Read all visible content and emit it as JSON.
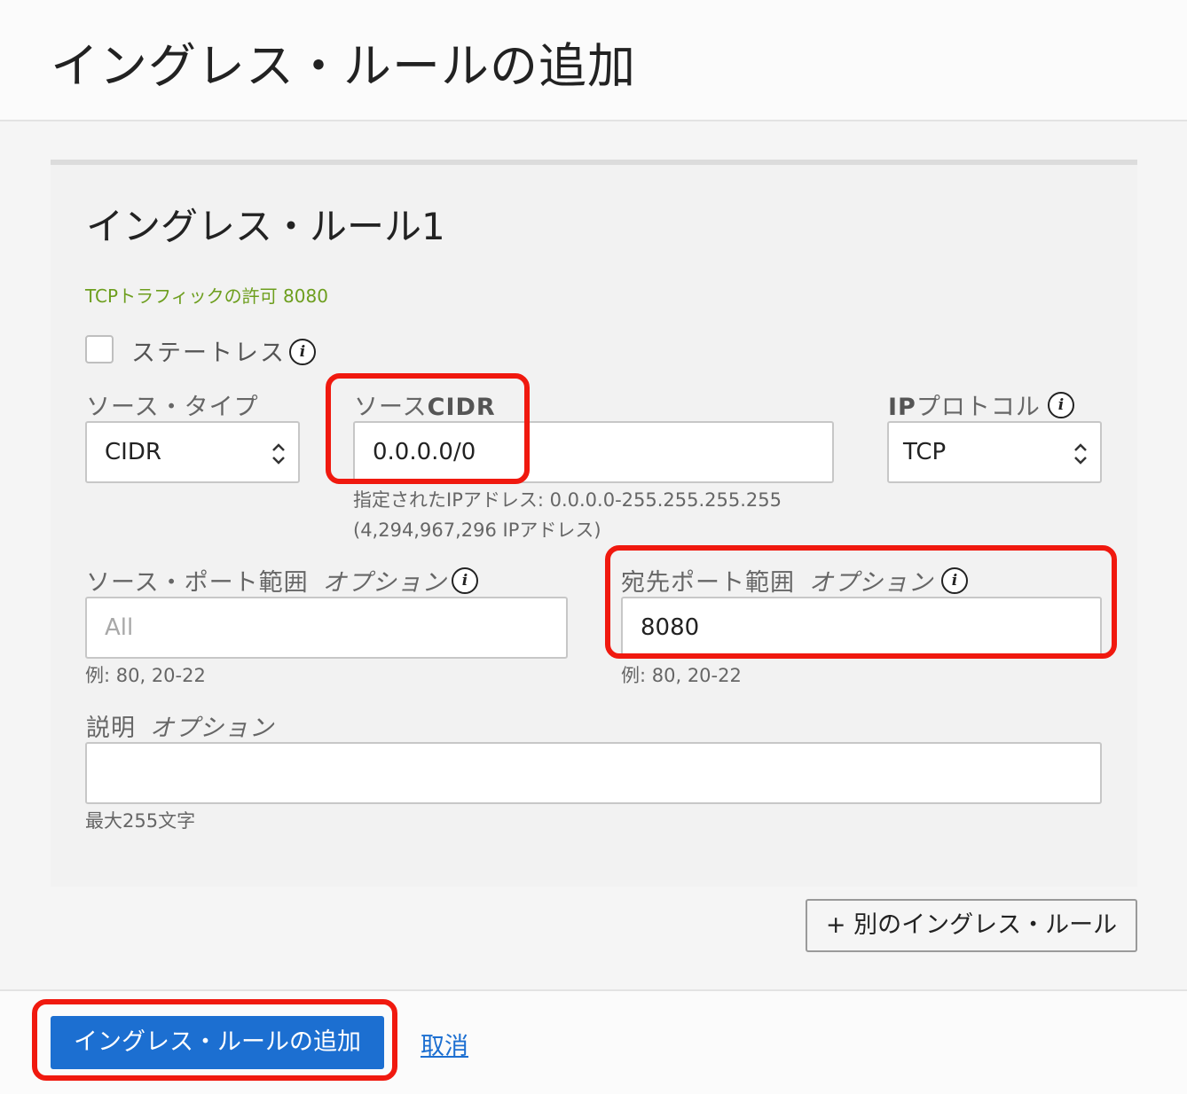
{
  "header": {
    "title": "イングレス・ルールの追加"
  },
  "panel": {
    "title": "イングレス・ルール1",
    "hint": "TCPトラフィックの許可 8080",
    "stateless_label": "ステートレス",
    "stateless_checked": false
  },
  "source_type": {
    "label": "ソース・タイプ",
    "value": "CIDR"
  },
  "source_cidr": {
    "label_prefix": "ソース",
    "label_bold": "CIDR",
    "value": "0.0.0.0/0",
    "helper_line1": "指定されたIPアドレス: 0.0.0.0-255.255.255.255",
    "helper_line2": "(4,294,967,296 IPアドレス)"
  },
  "ip_protocol": {
    "label_bold": "IP",
    "label_rest": "プロトコル",
    "value": "TCP"
  },
  "source_port": {
    "label": "ソース・ポート範囲",
    "optional": "オプション",
    "placeholder": "All",
    "helper": "例: 80, 20-22"
  },
  "dest_port": {
    "label": "宛先ポート範囲",
    "optional": "オプション",
    "value": "8080",
    "helper": "例: 80, 20-22"
  },
  "description": {
    "label": "説明",
    "optional": "オプション",
    "value": "",
    "helper": "最大255文字"
  },
  "add_another_label": "+ 別のイングレス・ルール",
  "footer": {
    "submit_label": "イングレス・ルールの追加",
    "cancel_label": "取消"
  },
  "info_icon_glyph": "i",
  "colors": {
    "primary": "#1c6fd1",
    "hint_green": "#6d9e1e",
    "highlight_red": "#f0190f"
  }
}
